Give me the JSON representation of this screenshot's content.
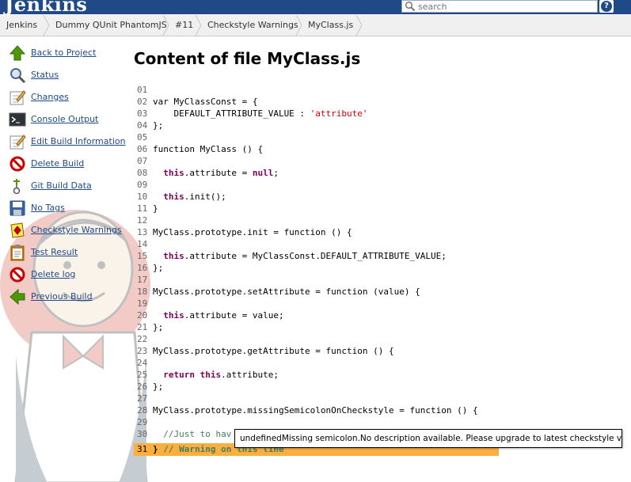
{
  "header": {
    "logo_text": "Jenkins",
    "search_placeholder": "search",
    "help_label": "?",
    "bar_color": "#204a87"
  },
  "breadcrumbs": [
    "Jenkins",
    "Dummy QUnit PhantomJS",
    "#11",
    "Checkstyle Warnings",
    "MyClass.js"
  ],
  "sidebar": {
    "link_color": "#204a87",
    "items": [
      {
        "label": "Back to Project",
        "icon": "up-arrow-icon"
      },
      {
        "label": "Status",
        "icon": "magnifier-icon"
      },
      {
        "label": "Changes",
        "icon": "notepad-icon"
      },
      {
        "label": "Console Output",
        "icon": "terminal-icon"
      },
      {
        "label": "Edit Build Information",
        "icon": "notepad-edit-icon"
      },
      {
        "label": "Delete Build",
        "icon": "no-entry-icon"
      },
      {
        "label": "Git Build Data",
        "icon": "git-icon"
      },
      {
        "label": "No Tags",
        "icon": "floppy-icon"
      },
      {
        "label": "Checkstyle Warnings",
        "icon": "checkstyle-icon"
      },
      {
        "label": "Test Result",
        "icon": "clipboard-icon"
      },
      {
        "label": "Delete log",
        "icon": "no-entry-icon"
      },
      {
        "label": "Previous Build",
        "icon": "left-arrow-icon"
      }
    ]
  },
  "main": {
    "title": "Content of file MyClass.js",
    "warning_highlight_color": "#fcaf3e",
    "code_lines": [
      {
        "n": "01",
        "segs": []
      },
      {
        "n": "02",
        "segs": [
          {
            "t": "var MyClassConst = {"
          }
        ]
      },
      {
        "n": "03",
        "segs": [
          {
            "t": "    DEFAULT_ATTRIBUTE_VALUE : "
          },
          {
            "t": "'attribute'",
            "c": "str"
          }
        ]
      },
      {
        "n": "04",
        "segs": [
          {
            "t": "};"
          }
        ]
      },
      {
        "n": "05",
        "segs": []
      },
      {
        "n": "06",
        "segs": [
          {
            "t": "function MyClass () {"
          }
        ]
      },
      {
        "n": "07",
        "segs": []
      },
      {
        "n": "08",
        "segs": [
          {
            "t": "  "
          },
          {
            "t": "this",
            "c": "kw"
          },
          {
            "t": ".attribute = "
          },
          {
            "t": "null",
            "c": "kw"
          },
          {
            "t": ";"
          }
        ]
      },
      {
        "n": "09",
        "segs": []
      },
      {
        "n": "10",
        "segs": [
          {
            "t": "  "
          },
          {
            "t": "this",
            "c": "kw"
          },
          {
            "t": ".init();"
          }
        ]
      },
      {
        "n": "11",
        "segs": [
          {
            "t": "}"
          }
        ]
      },
      {
        "n": "12",
        "segs": []
      },
      {
        "n": "13",
        "segs": [
          {
            "t": "MyClass.prototype.init = function () {"
          }
        ]
      },
      {
        "n": "14",
        "segs": []
      },
      {
        "n": "15",
        "segs": [
          {
            "t": "  "
          },
          {
            "t": "this",
            "c": "kw"
          },
          {
            "t": ".attribute = MyClassConst.DEFAULT_ATTRIBUTE_VALUE;"
          }
        ]
      },
      {
        "n": "16",
        "segs": [
          {
            "t": "};"
          }
        ]
      },
      {
        "n": "17",
        "segs": []
      },
      {
        "n": "18",
        "segs": [
          {
            "t": "MyClass.prototype.setAttribute = function (value) {"
          }
        ]
      },
      {
        "n": "19",
        "segs": []
      },
      {
        "n": "20",
        "segs": [
          {
            "t": "  "
          },
          {
            "t": "this",
            "c": "kw"
          },
          {
            "t": ".attribute = value;"
          }
        ]
      },
      {
        "n": "21",
        "segs": [
          {
            "t": "};"
          }
        ]
      },
      {
        "n": "22",
        "segs": []
      },
      {
        "n": "23",
        "segs": [
          {
            "t": "MyClass.prototype.getAttribute = function () {"
          }
        ]
      },
      {
        "n": "24",
        "segs": []
      },
      {
        "n": "25",
        "segs": [
          {
            "t": "  "
          },
          {
            "t": "return",
            "c": "kw"
          },
          {
            "t": " "
          },
          {
            "t": "this",
            "c": "kw"
          },
          {
            "t": ".attribute;"
          }
        ]
      },
      {
        "n": "26",
        "segs": [
          {
            "t": "};"
          }
        ]
      },
      {
        "n": "27",
        "segs": []
      },
      {
        "n": "28",
        "segs": [
          {
            "t": "MyClass.prototype.missingSemicolonOnCheckstyle = function () {"
          }
        ]
      },
      {
        "n": "29",
        "segs": []
      },
      {
        "n": "30",
        "segs": [
          {
            "t": "  "
          },
          {
            "t": "//Just to hav",
            "c": "cm"
          }
        ]
      },
      {
        "n": "31",
        "warn": true,
        "segs": [
          {
            "t": "}",
            "c": "brace"
          },
          {
            "t": " // Warning on this line",
            "c": "cm"
          }
        ]
      }
    ],
    "tooltip": "undefinedMissing semicolon.No description available. Please upgrade to latest checkstyle version."
  }
}
